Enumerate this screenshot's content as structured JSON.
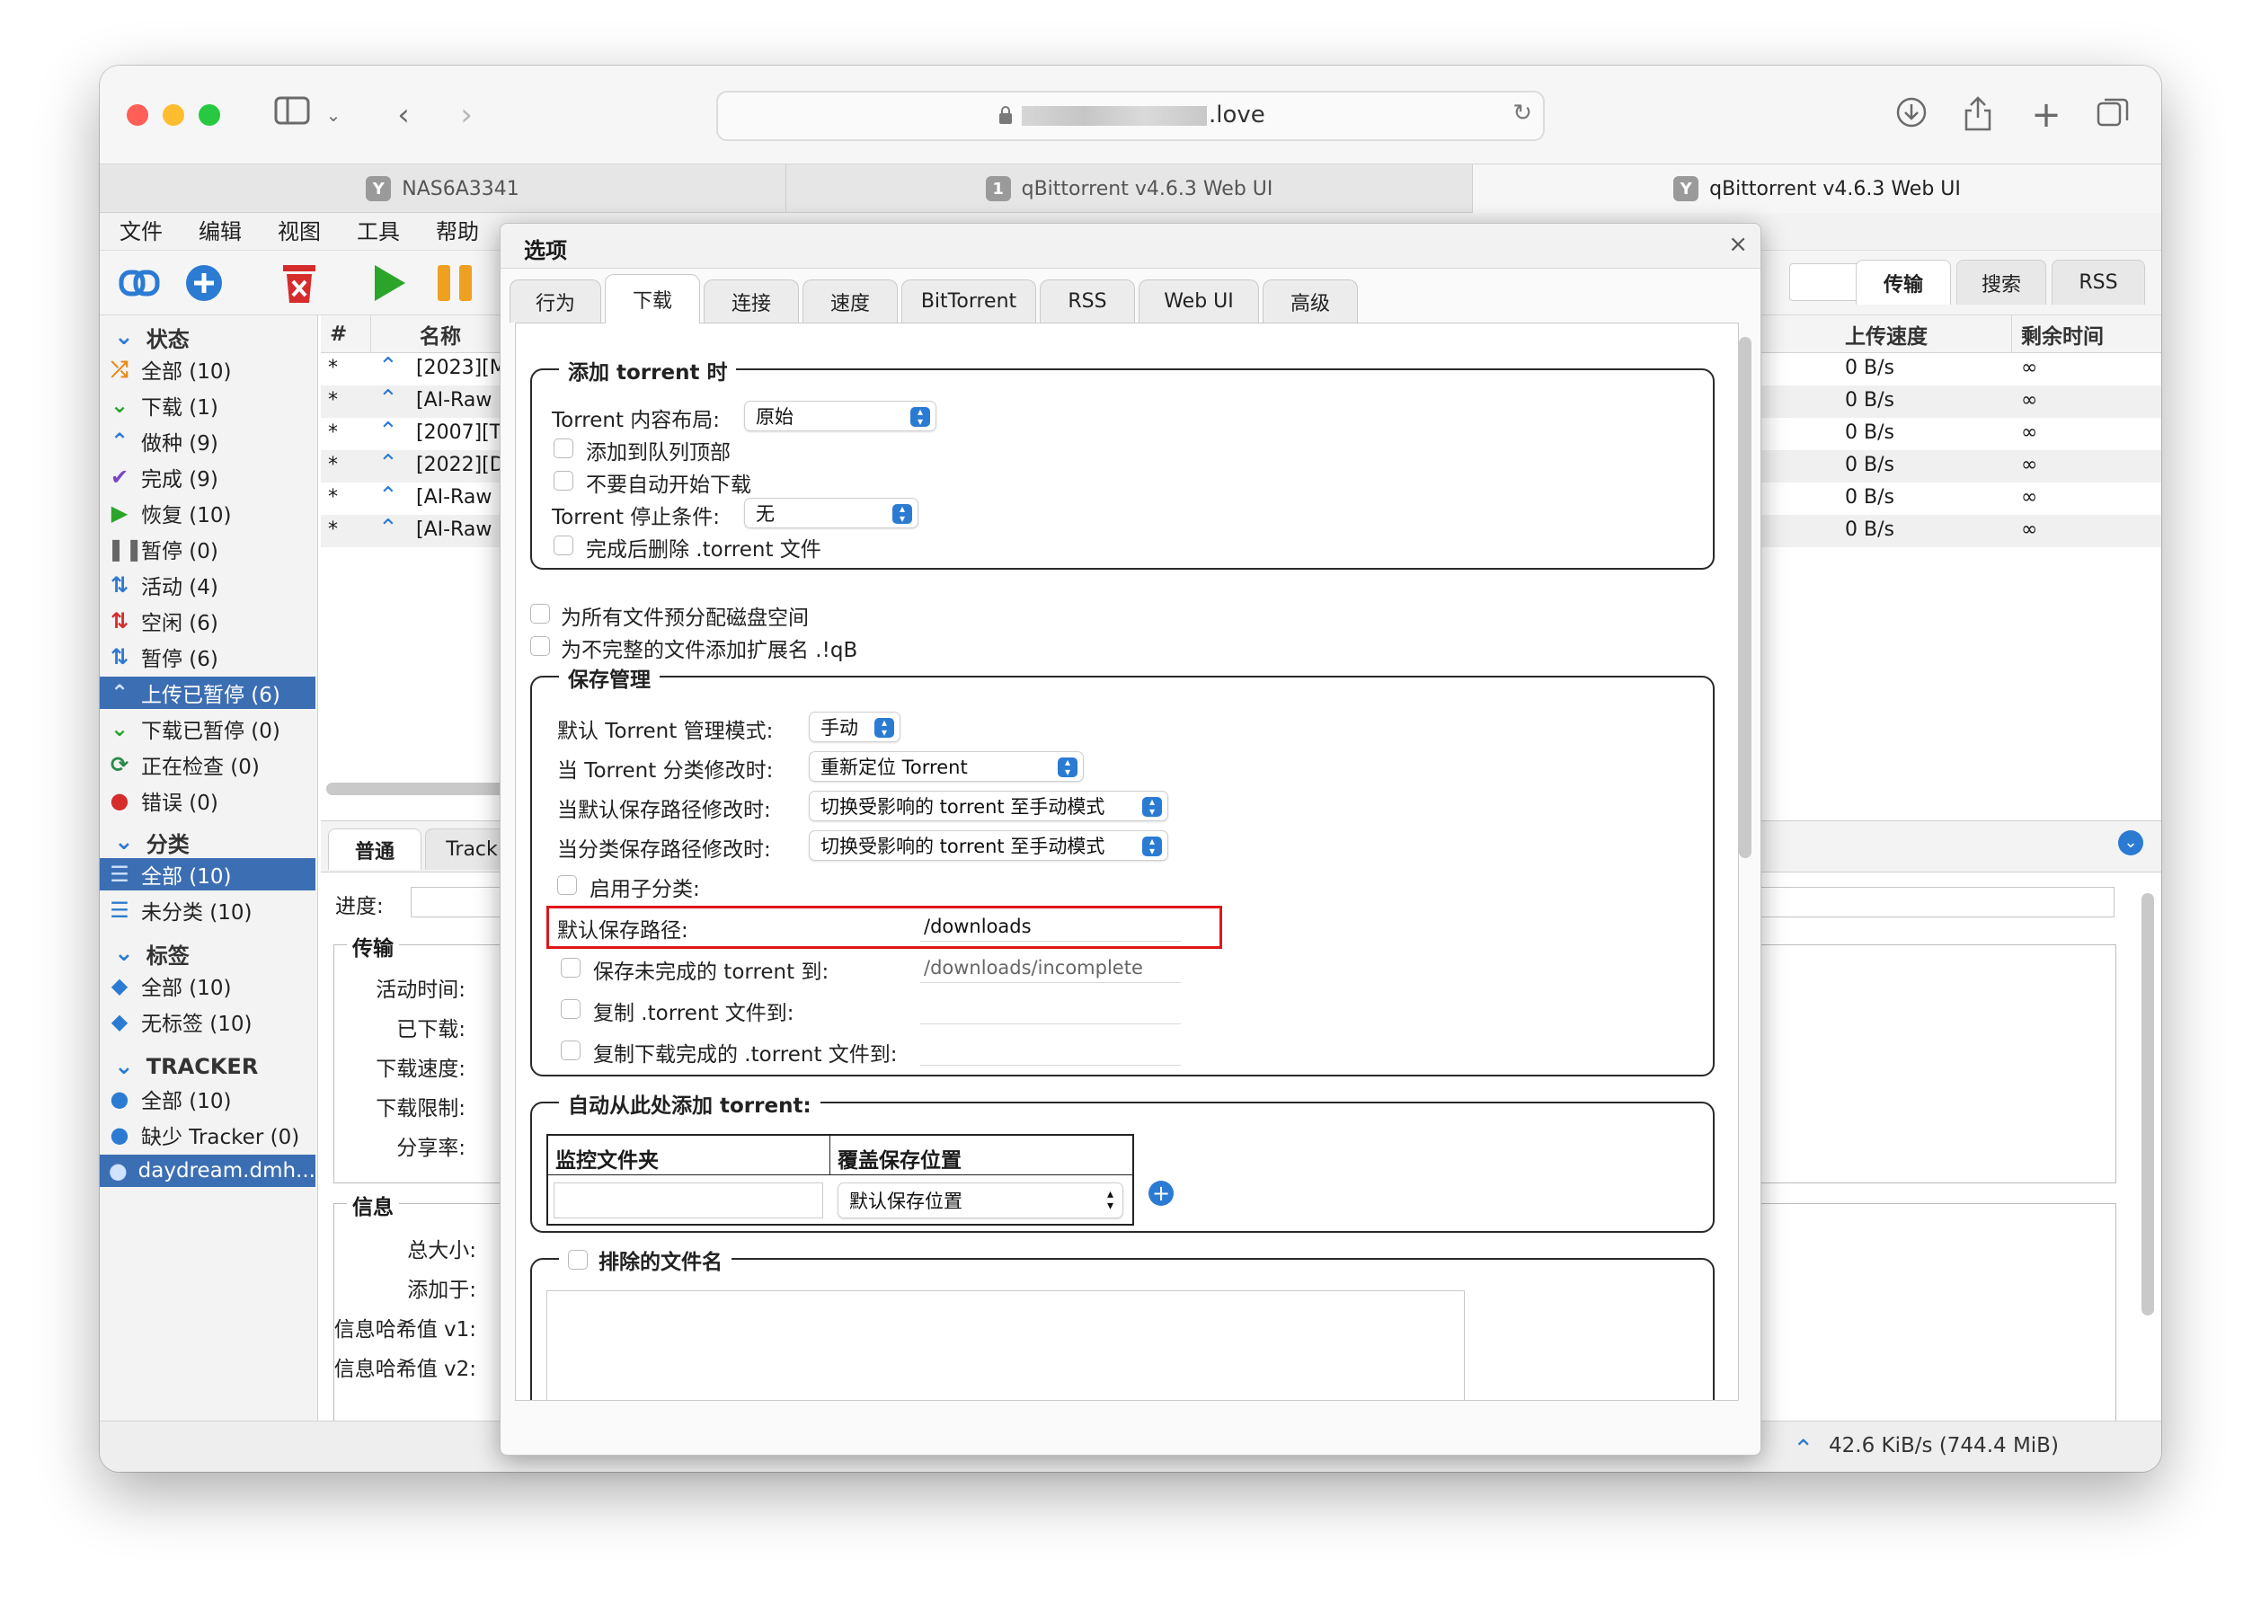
{
  "browser": {
    "url_domain": ".love",
    "tabs": [
      {
        "favicon": "Y",
        "title": "NAS6A3341"
      },
      {
        "favicon": "1",
        "title": "qBittorrent v4.6.3 Web UI"
      },
      {
        "favicon": "Y",
        "title": "qBittorrent v4.6.3 Web UI"
      }
    ]
  },
  "menu": [
    "文件",
    "编辑",
    "视图",
    "工具",
    "帮助"
  ],
  "right_tabs": [
    "传输",
    "搜索",
    "RSS"
  ],
  "sidebar": {
    "status_header": "状态",
    "status_items": [
      {
        "icon": "shuffle-icon",
        "label": "全部 (10)"
      },
      {
        "icon": "download-icon",
        "label": "下载 (1)"
      },
      {
        "icon": "seeding-icon",
        "label": "做种 (9)"
      },
      {
        "icon": "check-icon",
        "label": "完成 (9)"
      },
      {
        "icon": "resume-icon",
        "label": "恢复 (10)"
      },
      {
        "icon": "pause-icon",
        "label": "暂停 (0)"
      },
      {
        "icon": "active-icon",
        "label": "活动 (4)"
      },
      {
        "icon": "inactive-icon",
        "label": "空闲 (6)"
      },
      {
        "icon": "stalled-icon",
        "label": "暂停 (6)"
      },
      {
        "icon": "upload-paused-icon",
        "label": "上传已暂停 (6)"
      },
      {
        "icon": "download-paused-icon",
        "label": "下载已暂停 (0)"
      },
      {
        "icon": "checking-icon",
        "label": "正在检查 (0)"
      },
      {
        "icon": "error-icon",
        "label": "错误 (0)"
      }
    ],
    "category_header": "分类",
    "category_items": [
      {
        "label": "全部 (10)"
      },
      {
        "label": "未分类 (10)"
      }
    ],
    "tag_header": "标签",
    "tag_items": [
      {
        "label": "全部 (10)"
      },
      {
        "label": "无标签 (10)"
      }
    ],
    "tracker_header": "TRACKER",
    "tracker_items": [
      {
        "label": "全部 (10)"
      },
      {
        "label": "缺少 Tracker (0)"
      },
      {
        "label": "daydream.dmh..."
      }
    ]
  },
  "list": {
    "headers": {
      "num": "#",
      "name": "名称",
      "upspeed": "上传速度",
      "eta": "剩余时间"
    },
    "rows": [
      {
        "num": "*",
        "name": "[2023][M",
        "upspeed": "0 B/s",
        "eta": "∞"
      },
      {
        "num": "*",
        "name": "[AI-Raw",
        "upspeed": "0 B/s",
        "eta": "∞"
      },
      {
        "num": "*",
        "name": "[2007][T",
        "upspeed": "0 B/s",
        "eta": "∞"
      },
      {
        "num": "*",
        "name": "[2022][D",
        "upspeed": "0 B/s",
        "eta": "∞"
      },
      {
        "num": "*",
        "name": "[AI-Raw",
        "upspeed": "0 B/s",
        "eta": "∞"
      },
      {
        "num": "*",
        "name": "[AI-Raw",
        "upspeed": "0 B/s",
        "eta": "∞"
      }
    ]
  },
  "detail": {
    "tabs": [
      "普通",
      "Track"
    ],
    "progress_label": "进度:",
    "transfer_header": "传输",
    "transfer_labels": [
      "活动时间:",
      "已下载:",
      "下载速度:",
      "下载限制:",
      "分享率:"
    ],
    "info_header": "信息",
    "info_labels": [
      "总大小:",
      "添加于:",
      "信息哈希值 v1:",
      "信息哈希值 v2:"
    ]
  },
  "statusbar": {
    "upload": "42.6 KiB/s (744.4 MiB)"
  },
  "dialog": {
    "title": "选项",
    "tabs": [
      "行为",
      "下载",
      "连接",
      "速度",
      "BitTorrent",
      "RSS",
      "Web UI",
      "高级"
    ],
    "add_torrent": {
      "legend": "添加 torrent 时",
      "content_layout_label": "Torrent 内容布局:",
      "content_layout_value": "原始",
      "add_top_label": "添加到队列顶部",
      "no_autostart_label": "不要自动开始下载",
      "stop_condition_label": "Torrent 停止条件:",
      "stop_condition_value": "无",
      "delete_after_label": "完成后删除 .torrent 文件"
    },
    "preallocate_label": "为所有文件预分配磁盘空间",
    "append_ext_label": "为不完整的文件添加扩展名 .!qB",
    "save_mgmt": {
      "legend": "保存管理",
      "rows": [
        {
          "label": "默认 Torrent 管理模式:",
          "value": "手动"
        },
        {
          "label": "当 Torrent 分类修改时:",
          "value": "重新定位 Torrent"
        },
        {
          "label": "当默认保存路径修改时:",
          "value": "切换受影响的 torrent 至手动模式"
        },
        {
          "label": "当分类保存路径修改时:",
          "value": "切换受影响的 torrent 至手动模式"
        }
      ],
      "subcategory_label": "启用子分类:",
      "default_path_label": "默认保存路径:",
      "default_path_value": "/downloads",
      "incomplete_label": "保存未完成的 torrent 到:",
      "incomplete_value": "/downloads/incomplete",
      "copy_torrent_label": "复制 .torrent 文件到:",
      "copy_finished_label": "复制下载完成的 .torrent 文件到:"
    },
    "auto_add": {
      "legend": "自动从此处添加 torrent:",
      "col_watch": "监控文件夹",
      "col_override": "覆盖保存位置",
      "override_value": "默认保存位置"
    },
    "exclude": {
      "legend": "排除的文件名"
    }
  },
  "colors": {
    "accent": "#2b7bd3",
    "highlight": "#e0161b",
    "selected": "#3c6eb4"
  }
}
